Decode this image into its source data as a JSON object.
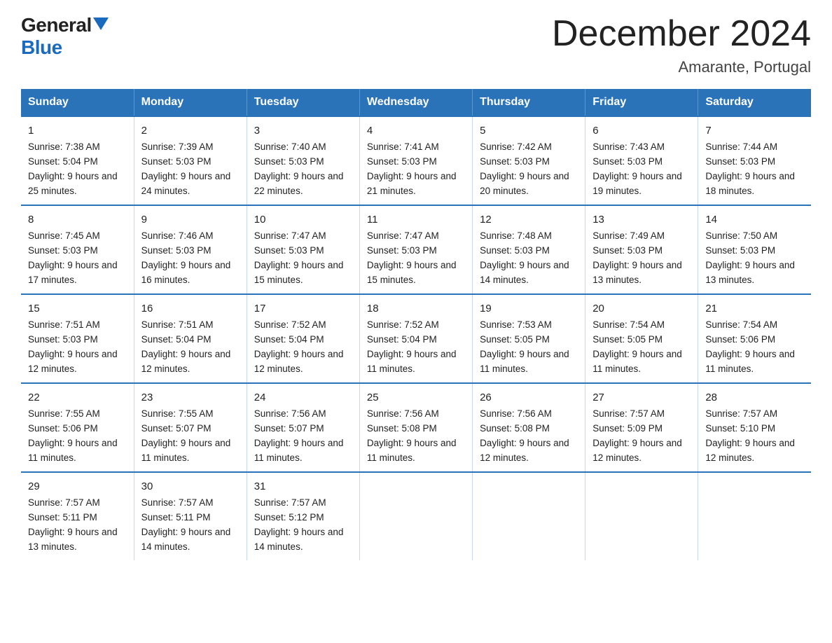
{
  "logo": {
    "general": "General",
    "blue": "Blue"
  },
  "title": "December 2024",
  "subtitle": "Amarante, Portugal",
  "days_of_week": [
    "Sunday",
    "Monday",
    "Tuesday",
    "Wednesday",
    "Thursday",
    "Friday",
    "Saturday"
  ],
  "weeks": [
    [
      {
        "day": "1",
        "sunrise": "7:38 AM",
        "sunset": "5:04 PM",
        "daylight": "9 hours and 25 minutes."
      },
      {
        "day": "2",
        "sunrise": "7:39 AM",
        "sunset": "5:03 PM",
        "daylight": "9 hours and 24 minutes."
      },
      {
        "day": "3",
        "sunrise": "7:40 AM",
        "sunset": "5:03 PM",
        "daylight": "9 hours and 22 minutes."
      },
      {
        "day": "4",
        "sunrise": "7:41 AM",
        "sunset": "5:03 PM",
        "daylight": "9 hours and 21 minutes."
      },
      {
        "day": "5",
        "sunrise": "7:42 AM",
        "sunset": "5:03 PM",
        "daylight": "9 hours and 20 minutes."
      },
      {
        "day": "6",
        "sunrise": "7:43 AM",
        "sunset": "5:03 PM",
        "daylight": "9 hours and 19 minutes."
      },
      {
        "day": "7",
        "sunrise": "7:44 AM",
        "sunset": "5:03 PM",
        "daylight": "9 hours and 18 minutes."
      }
    ],
    [
      {
        "day": "8",
        "sunrise": "7:45 AM",
        "sunset": "5:03 PM",
        "daylight": "9 hours and 17 minutes."
      },
      {
        "day": "9",
        "sunrise": "7:46 AM",
        "sunset": "5:03 PM",
        "daylight": "9 hours and 16 minutes."
      },
      {
        "day": "10",
        "sunrise": "7:47 AM",
        "sunset": "5:03 PM",
        "daylight": "9 hours and 15 minutes."
      },
      {
        "day": "11",
        "sunrise": "7:47 AM",
        "sunset": "5:03 PM",
        "daylight": "9 hours and 15 minutes."
      },
      {
        "day": "12",
        "sunrise": "7:48 AM",
        "sunset": "5:03 PM",
        "daylight": "9 hours and 14 minutes."
      },
      {
        "day": "13",
        "sunrise": "7:49 AM",
        "sunset": "5:03 PM",
        "daylight": "9 hours and 13 minutes."
      },
      {
        "day": "14",
        "sunrise": "7:50 AM",
        "sunset": "5:03 PM",
        "daylight": "9 hours and 13 minutes."
      }
    ],
    [
      {
        "day": "15",
        "sunrise": "7:51 AM",
        "sunset": "5:03 PM",
        "daylight": "9 hours and 12 minutes."
      },
      {
        "day": "16",
        "sunrise": "7:51 AM",
        "sunset": "5:04 PM",
        "daylight": "9 hours and 12 minutes."
      },
      {
        "day": "17",
        "sunrise": "7:52 AM",
        "sunset": "5:04 PM",
        "daylight": "9 hours and 12 minutes."
      },
      {
        "day": "18",
        "sunrise": "7:52 AM",
        "sunset": "5:04 PM",
        "daylight": "9 hours and 11 minutes."
      },
      {
        "day": "19",
        "sunrise": "7:53 AM",
        "sunset": "5:05 PM",
        "daylight": "9 hours and 11 minutes."
      },
      {
        "day": "20",
        "sunrise": "7:54 AM",
        "sunset": "5:05 PM",
        "daylight": "9 hours and 11 minutes."
      },
      {
        "day": "21",
        "sunrise": "7:54 AM",
        "sunset": "5:06 PM",
        "daylight": "9 hours and 11 minutes."
      }
    ],
    [
      {
        "day": "22",
        "sunrise": "7:55 AM",
        "sunset": "5:06 PM",
        "daylight": "9 hours and 11 minutes."
      },
      {
        "day": "23",
        "sunrise": "7:55 AM",
        "sunset": "5:07 PM",
        "daylight": "9 hours and 11 minutes."
      },
      {
        "day": "24",
        "sunrise": "7:56 AM",
        "sunset": "5:07 PM",
        "daylight": "9 hours and 11 minutes."
      },
      {
        "day": "25",
        "sunrise": "7:56 AM",
        "sunset": "5:08 PM",
        "daylight": "9 hours and 11 minutes."
      },
      {
        "day": "26",
        "sunrise": "7:56 AM",
        "sunset": "5:08 PM",
        "daylight": "9 hours and 12 minutes."
      },
      {
        "day": "27",
        "sunrise": "7:57 AM",
        "sunset": "5:09 PM",
        "daylight": "9 hours and 12 minutes."
      },
      {
        "day": "28",
        "sunrise": "7:57 AM",
        "sunset": "5:10 PM",
        "daylight": "9 hours and 12 minutes."
      }
    ],
    [
      {
        "day": "29",
        "sunrise": "7:57 AM",
        "sunset": "5:11 PM",
        "daylight": "9 hours and 13 minutes."
      },
      {
        "day": "30",
        "sunrise": "7:57 AM",
        "sunset": "5:11 PM",
        "daylight": "9 hours and 14 minutes."
      },
      {
        "day": "31",
        "sunrise": "7:57 AM",
        "sunset": "5:12 PM",
        "daylight": "9 hours and 14 minutes."
      },
      null,
      null,
      null,
      null
    ]
  ]
}
